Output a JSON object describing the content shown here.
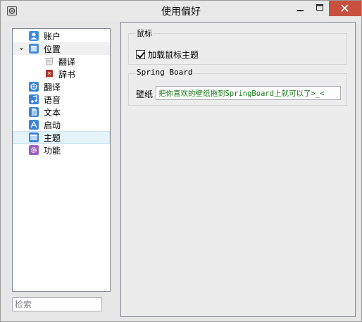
{
  "window": {
    "title": "使用偏好"
  },
  "sidebar": {
    "items": [
      {
        "label": "账户",
        "icon": "user-icon",
        "color": "#3f8edc"
      },
      {
        "label": "位置",
        "icon": "location-icon",
        "color": "#4a90d9",
        "expanded": true
      },
      {
        "label": "翻译",
        "icon": "translate-icon",
        "color": "#e0e0e0",
        "child": true
      },
      {
        "label": "辞书",
        "icon": "dictionary-icon",
        "color": "#a8312e",
        "child": true
      },
      {
        "label": "翻译",
        "icon": "translate-globe-icon",
        "color": "#3a84d6"
      },
      {
        "label": "语音",
        "icon": "music-note-icon",
        "color": "#3a84d6"
      },
      {
        "label": "文本",
        "icon": "document-icon",
        "color": "#3a84d6"
      },
      {
        "label": "启动",
        "icon": "launch-icon",
        "color": "#3a84d6"
      },
      {
        "label": "主题",
        "icon": "theme-icon",
        "color": "#3a84d6",
        "selected": true
      },
      {
        "label": "功能",
        "icon": "gear-icon",
        "color": "#9b5fc0"
      }
    ],
    "search_placeholder": "检索"
  },
  "mouse_group": {
    "title": "鼠标",
    "checkbox_label": "加载鼠标主题",
    "checked": true
  },
  "springboard_group": {
    "title": "Spring Board",
    "wallpaper_label": "壁纸",
    "wallpaper_value": "把你喜欢的壁纸拖到SpringBoard上就可以了>_<"
  }
}
